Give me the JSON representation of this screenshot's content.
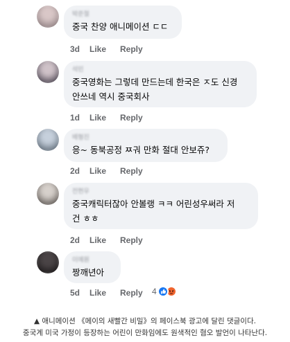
{
  "comments": [
    {
      "author": "박준철",
      "lines": [
        "중국 찬양 애니메이션 ㄷㄷ"
      ],
      "time": "3d",
      "like": "Like",
      "reply": "Reply",
      "avatar_colors": [
        "#d9c7c7",
        "#8d7e80"
      ]
    },
    {
      "author": "석민",
      "lines": [
        "중국영화는 그렇데 만드는데 한국은 ㅈ도 신경",
        "안쓰네 역시 중국회사"
      ],
      "time": "1d",
      "like": "Like",
      "reply": "Reply",
      "avatar_colors": [
        "#cfc2c8",
        "#4b4450"
      ]
    },
    {
      "author": "배형진",
      "lines": [
        "응~ 동북공정 ㅉ궈 만화 절대 안보쥬?"
      ],
      "time": "2d",
      "like": "Like",
      "reply": "Reply",
      "avatar_colors": [
        "#c6d0dc",
        "#606c78"
      ]
    },
    {
      "author": "전현우",
      "lines": [
        "중국캐릭터잖아 안볼랭 ㅋㅋ 어린성우써라 저",
        "건 ㅎㅎ"
      ],
      "time": "2d",
      "like": "Like",
      "reply": "Reply",
      "avatar_colors": [
        "#d6d0cb",
        "#5d5753"
      ]
    },
    {
      "author": "이예원",
      "lines": [
        "짱깨년아"
      ],
      "time": "5d",
      "like": "Like",
      "reply": "Reply",
      "avatar_colors": [
        "#4a4446",
        "#1b1819"
      ]
    }
  ],
  "reactions": {
    "count": "4",
    "icons": [
      "like-icon",
      "angry-icon"
    ],
    "colors": {
      "like": "#1877f2",
      "angry": "#f0642e"
    }
  },
  "caption": {
    "line1": "▲ 애니메이션 《메이의 새빨간 비밀》의 페이스북 광고에 달린 댓글이다.",
    "line2": "중국계 미국 가정이 등장하는 어린이 만화임에도 원색적인 혐오 발언이 나타난다."
  }
}
